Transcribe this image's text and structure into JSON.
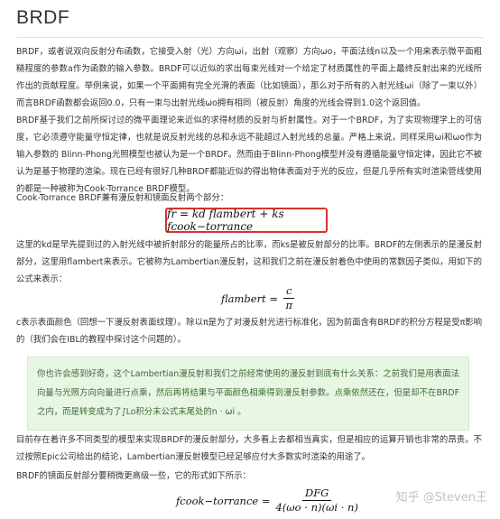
{
  "title": "BRDF",
  "p1": "BRDF，或者说双向反射分布函数，它接受入射（光）方向ωi，出射（观察）方向ωo，平面法线n以及一个用来表示微平面粗糙程度的参数a作为函数的输入参数。BRDF可以近似的求出每束光线对一个给定了材质属性的平面上最终反射出来的光线所作出的贡献程度。举例来说，如果一个平面拥有完全光滑的表面（比如镜面），那么对于所有的入射光线ωi（除了一束以外）而言BRDF函数都会返回0.0，只有一束与出射光线ωo拥有相同（被反射）角度的光线会得到1.0这个返回值。",
  "p2": "BRDF基于我们之前所探讨过的微平面理论来近似的求得材质的反射与折射属性。对于一个BRDF，为了实现物理学上的可信度，它必须遵守能量守恒定律，也就是说反射光线的总和永远不能超过入射光线的总量。严格上来说，同样采用ωi和ωo作为输入参数的 Blinn-Phong光照模型也被认为是一个BRDF。然而由于Blinn-Phong模型并没有遵循能量守恒定律，因此它不被认为是基于物理的渲染。现在已经有很好几种BRDF都能近似的得出物体表面对于光的反应，但是几乎所有实时渲染管线使用的都是一种被称为Cook-Torrance BRDF模型。",
  "p3": "Cook-Torrance BRDF兼有漫反射和镜面反射两个部分：",
  "eq1": "fr = kd flambert + ks fcook−torrance",
  "p4": "这里的kd是早先提到过的入射光线中被折射部分的能量所占的比率，而ks是被反射部分的比率。BRDF的左侧表示的是漫反射部分，这里用flambert来表示。它被称为Lambertian漫反射，这和我们之前在漫反射着色中使用的常数因子类似，用如下的公式来表示：",
  "eq2": {
    "lhs": "flambert =",
    "num": "c",
    "den": "π"
  },
  "p5": "c表示表面颜色（回想一下漫反射表面纹理）。除以π是为了对漫反射光进行标准化，因为前面含有BRDF的积分方程是受π影响的（我们会在IBL的教程中探讨这个问题的）。",
  "note": "你也许会感到好奇，这个Lambertian漫反射和我们之前经常使用的漫反射到底有什么关系：之前我们是用表面法向量与光照方向向量进行点乘，然后再将结果与平面颜色相乘得到漫反射参数。点乘依然还在，但是却不在BRDF之内，而是转变成为了∫Lo积分末公式末尾处的n · ωi 。",
  "p6": "目前存在着许多不同类型的模型来实现BRDF的漫反射部分，大多看上去都相当真实，但是相应的运算开销也非常的昂贵。不过按照Epic公司给出的结论，Lambertian漫反射模型已经足够应付大多数实时渲染的用途了。",
  "p7": "BRDF的镜面反射部分要稍微更高级一些，它的形式如下所示：",
  "eq3": {
    "lhs": "fcook−torrance =",
    "num": "DFG",
    "den": "4(ωo · n)(ωi · n)"
  },
  "watermark": "知乎 @Steven王"
}
